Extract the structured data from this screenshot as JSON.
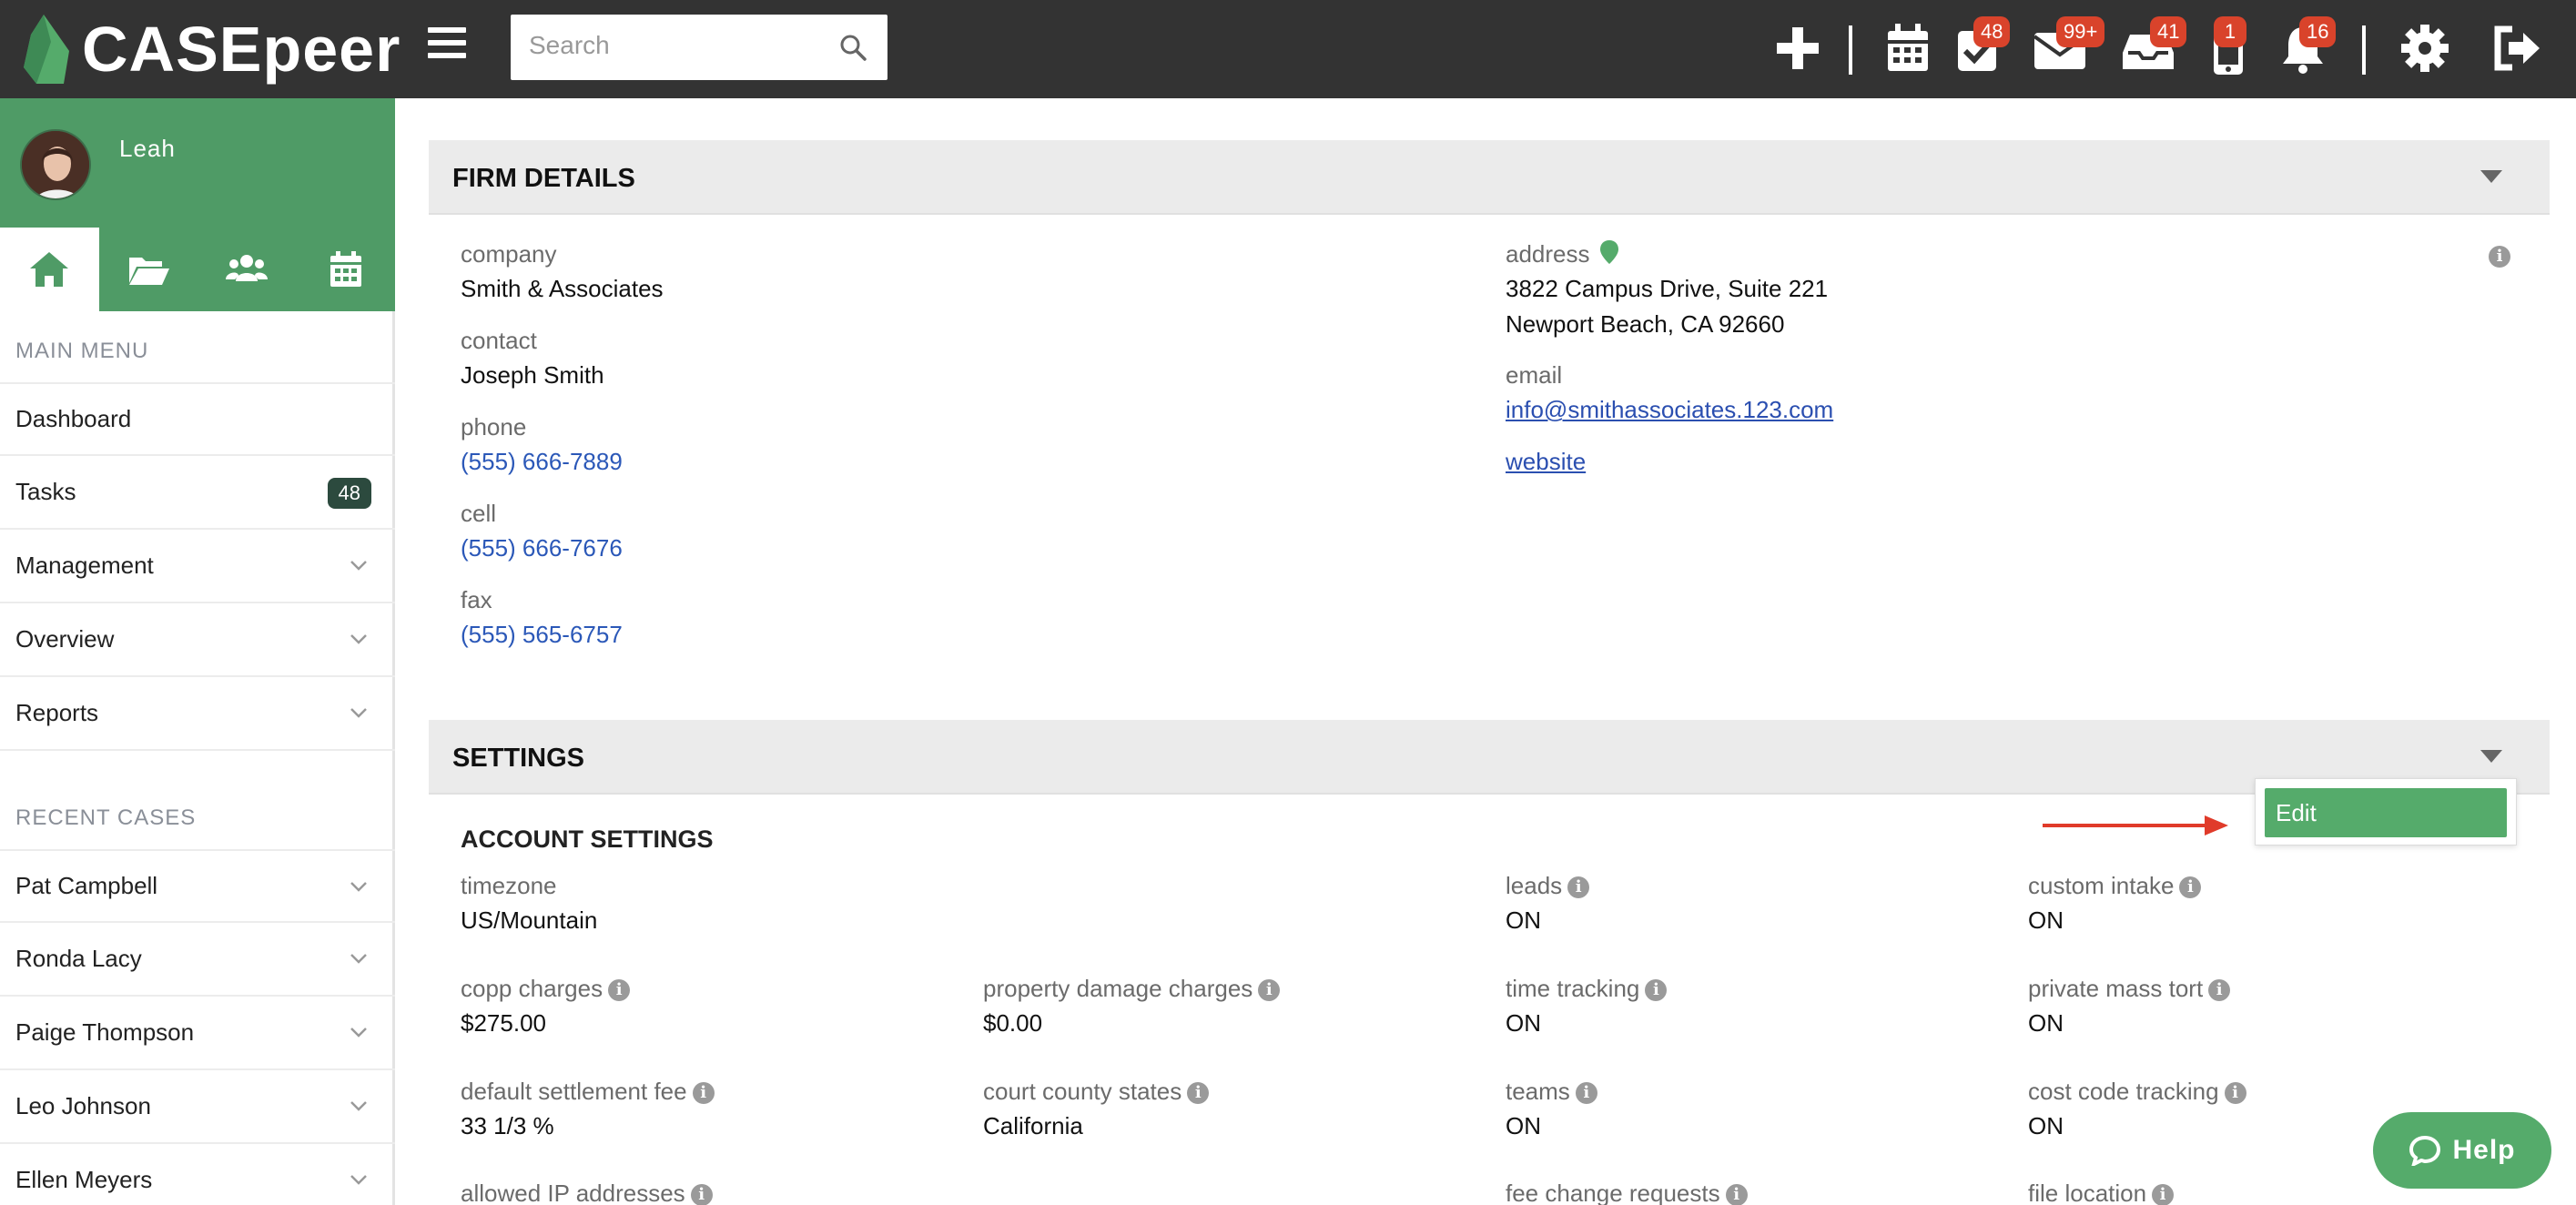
{
  "brand": {
    "name": "CASEpeer",
    "accent": "#55ab6b",
    "topbar_bg": "#333333"
  },
  "search": {
    "placeholder": "Search"
  },
  "topbar": {
    "badges": {
      "tasks": "48",
      "mail": "99+",
      "inbox": "41",
      "mobile": "1",
      "notifications": "16"
    }
  },
  "user": {
    "name": "Leah"
  },
  "sidebar": {
    "main_menu_heading": "MAIN MENU",
    "main_menu": [
      {
        "label": "Dashboard"
      },
      {
        "label": "Tasks",
        "badge": "48"
      },
      {
        "label": "Management"
      },
      {
        "label": "Overview"
      },
      {
        "label": "Reports"
      }
    ],
    "recent_heading": "RECENT CASES",
    "recent_cases": [
      {
        "label": "Pat Campbell"
      },
      {
        "label": "Ronda Lacy"
      },
      {
        "label": "Paige Thompson"
      },
      {
        "label": "Leo Johnson"
      },
      {
        "label": "Ellen Meyers"
      }
    ]
  },
  "firm": {
    "title": "FIRM DETAILS",
    "company_label": "company",
    "company": "Smith & Associates",
    "contact_label": "contact",
    "contact": "Joseph Smith",
    "phone_label": "phone",
    "phone": "(555) 666-7889",
    "cell_label": "cell",
    "cell": "(555) 666-7676",
    "fax_label": "fax",
    "fax": "(555) 565-6757",
    "address_label": "address",
    "address_line1": "3822 Campus Drive, Suite 221",
    "address_line2": "Newport Beach, CA 92660",
    "email_label": "email",
    "email": "info@smithassociates.123.com ",
    "website": "website "
  },
  "settings": {
    "title": "SETTINGS",
    "edit_label": "Edit",
    "account_heading": "ACCOUNT SETTINGS",
    "timezone_label": "timezone",
    "timezone": "US/Mountain",
    "leads_label": "leads",
    "leads": "ON",
    "custom_intake_label": "custom intake",
    "custom_intake": "ON",
    "copp_label": "copp charges",
    "copp": "$275.00",
    "property_label": "property damage charges",
    "property": "$0.00",
    "time_tracking_label": "time tracking",
    "time_tracking": "ON",
    "mass_tort_label": "private mass tort",
    "mass_tort": "ON",
    "settlement_label": "default settlement fee",
    "settlement": "33 1/3 %",
    "court_label": "court county states",
    "court": "California",
    "teams_label": "teams",
    "teams": "ON",
    "cost_code_label": "cost code tracking",
    "cost_code": "ON",
    "ip_label": "allowed IP addresses",
    "fee_change_label": "fee change requests",
    "file_location_label": "file location"
  },
  "help": {
    "label": "Help"
  }
}
